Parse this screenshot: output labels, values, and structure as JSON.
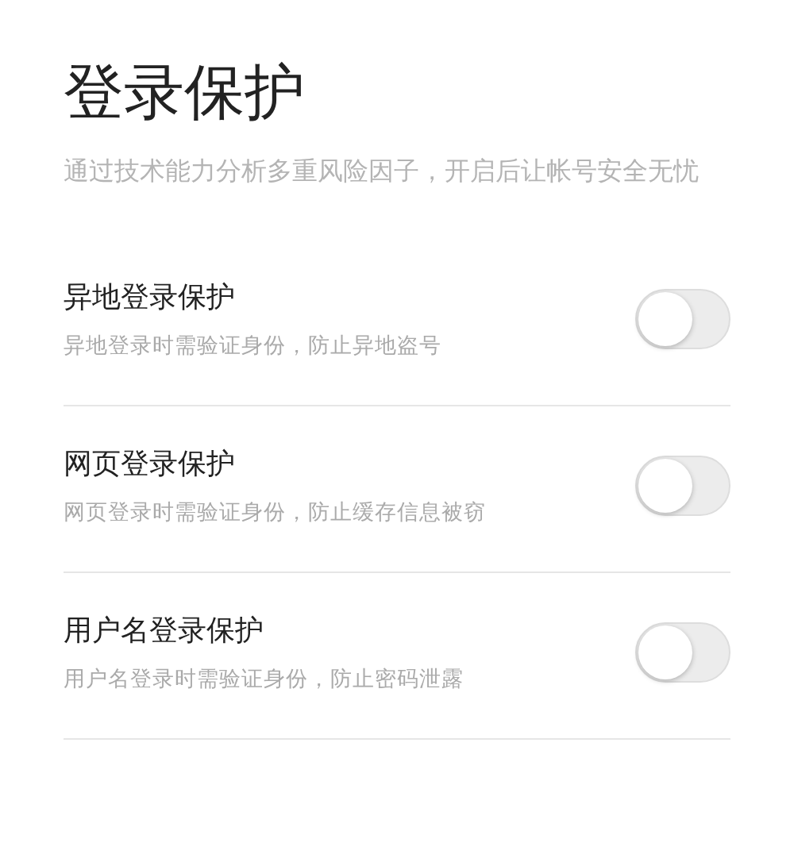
{
  "title": "登录保护",
  "description": "通过技术能力分析多重风险因子，开启后让帐号安全无忧",
  "settings": [
    {
      "label": "异地登录保护",
      "hint": "异地登录时需验证身份，防止异地盗号",
      "on": false
    },
    {
      "label": "网页登录保护",
      "hint": "网页登录时需验证身份，防止缓存信息被窃",
      "on": false
    },
    {
      "label": "用户名登录保护",
      "hint": "用户名登录时需验证身份，防止密码泄露",
      "on": false
    }
  ]
}
